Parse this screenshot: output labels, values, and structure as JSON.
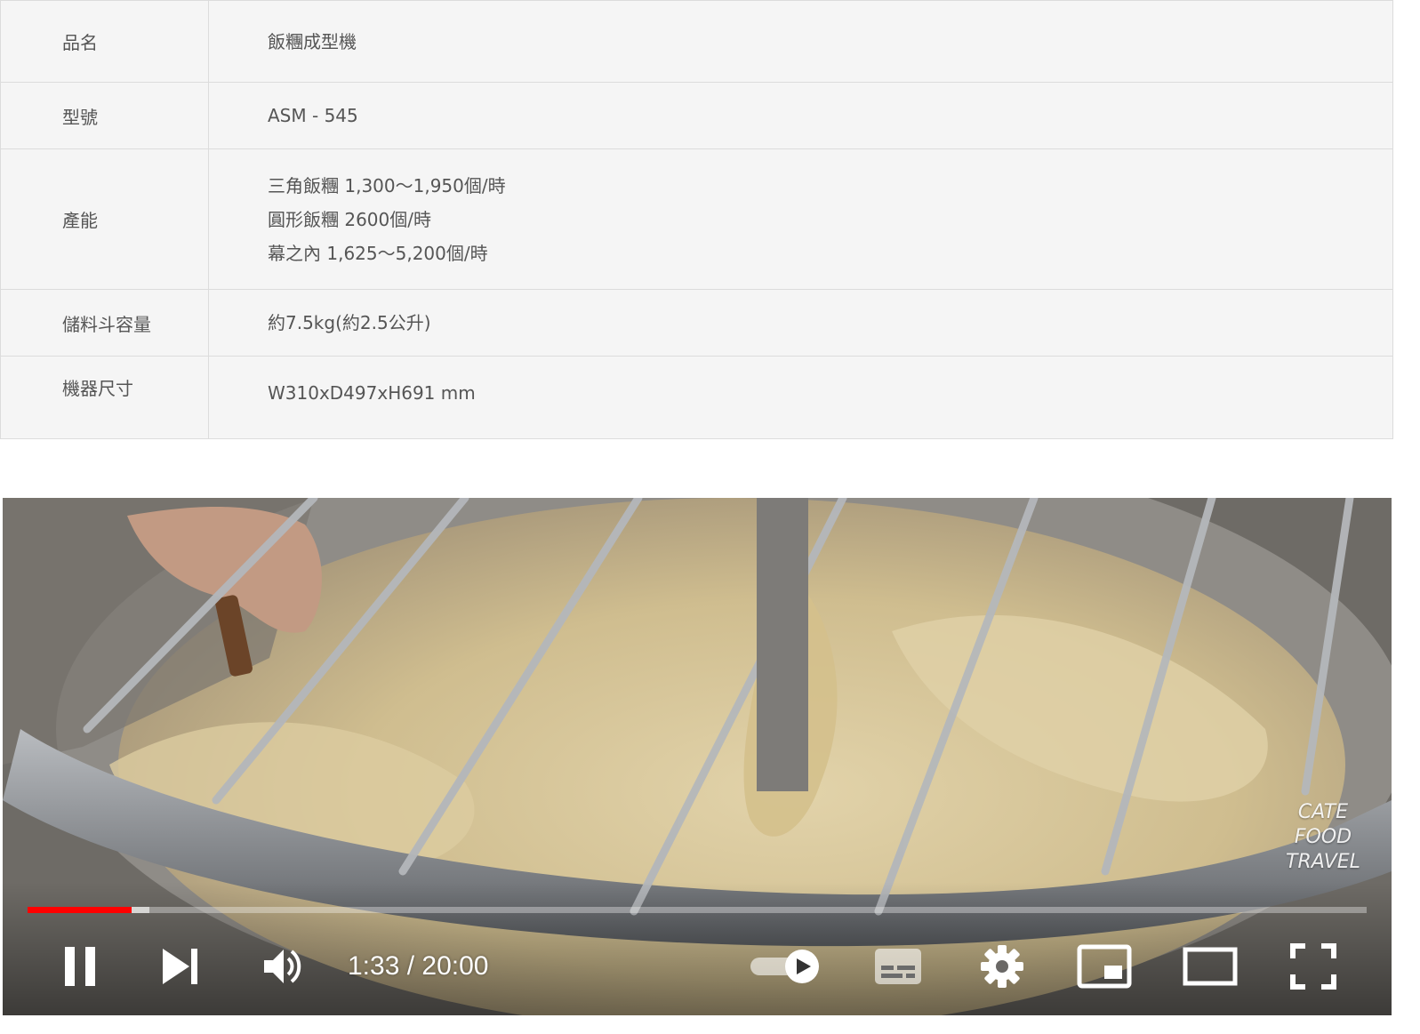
{
  "spec_table": {
    "rows": [
      {
        "label": "品名",
        "lines": [
          "飯糰成型機"
        ]
      },
      {
        "label": "型號",
        "lines": [
          "ASM - 545"
        ]
      },
      {
        "label": "產能",
        "lines": [
          "三角飯糰 1,300～1,950個/時",
          "圓形飯糰 2600個/時",
          "幕之內 1,625～5,200個/時"
        ]
      },
      {
        "label": "儲料斗容量",
        "lines": [
          "約7.5kg(約2.5公升)"
        ]
      },
      {
        "label": "機器尺寸",
        "lines": [
          "W310xD497xH691 mm"
        ]
      }
    ]
  },
  "video": {
    "watermark": [
      "CATE",
      "FOOD",
      "TRAVEL"
    ],
    "time_display": "1:33 / 20:00",
    "progress_played": 0.0775,
    "progress_buffered": 0.091,
    "progress_color": "#ff0000",
    "autoplay_on": true,
    "icons": {
      "play_pause": "pause-icon",
      "next": "next-icon",
      "volume": "volume-icon",
      "autoplay": "autoplay-toggle-icon",
      "subtitles": "subtitles-icon",
      "settings": "gear-icon",
      "miniplayer": "miniplayer-icon",
      "theater": "theater-mode-icon",
      "fullscreen": "fullscreen-icon"
    }
  }
}
